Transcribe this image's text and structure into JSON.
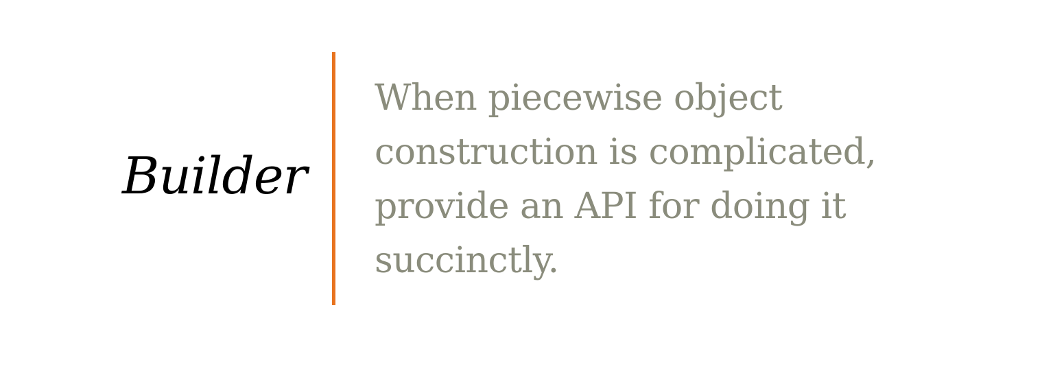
{
  "slide": {
    "title": "Builder",
    "description_lines": [
      "When piecewise object",
      "construction is complicated,",
      "provide an API for doing it",
      "succinctly."
    ]
  },
  "colors": {
    "title": "#000000",
    "description": "#8a8c7c",
    "divider": "#e8731f",
    "background": "#ffffff"
  }
}
